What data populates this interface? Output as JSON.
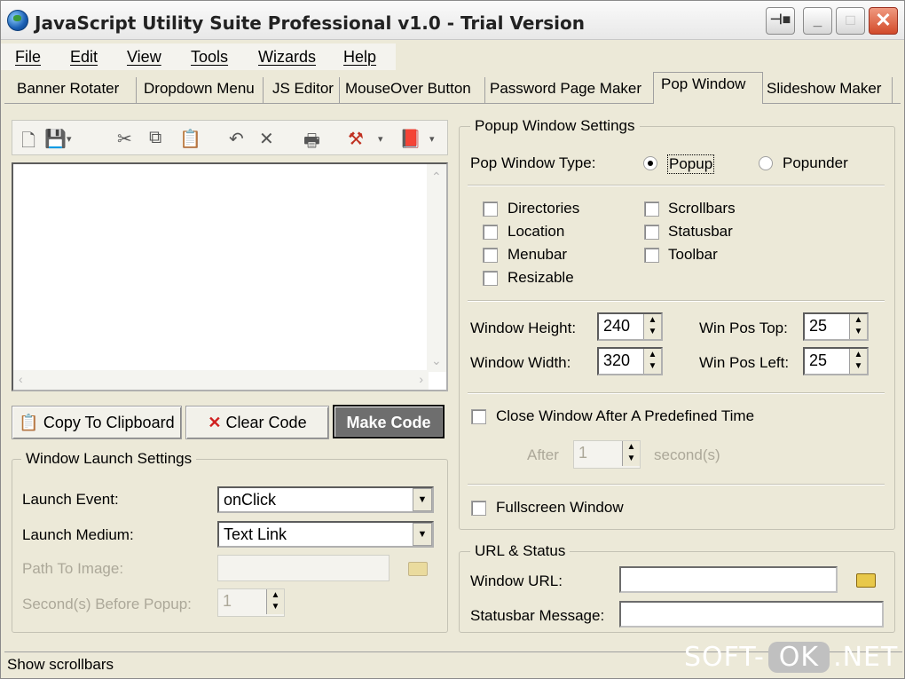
{
  "app": {
    "title": "JavaScript Utility Suite Professional v1.0 - Trial Version"
  },
  "menu": [
    "File",
    "Edit",
    "View",
    "Tools",
    "Wizards",
    "Help"
  ],
  "tabs": [
    "Banner Rotater",
    "Dropdown Menu",
    "JS Editor",
    "MouseOver Button",
    "Password Page Maker",
    "Pop Window",
    "Slideshow Maker"
  ],
  "active_tab": "Pop Window",
  "buttons": {
    "copy": "Copy To Clipboard",
    "clear": "Clear Code",
    "make": "Make Code"
  },
  "launch": {
    "title": "Window Launch Settings",
    "event_label": "Launch Event:",
    "event_value": "onClick",
    "medium_label": "Launch Medium:",
    "medium_value": "Text Link",
    "path_label": "Path To Image:",
    "seconds_label": "Second(s) Before Popup:",
    "seconds_value": "1"
  },
  "popup": {
    "title": "Popup Window Settings",
    "type_label": "Pop Window Type:",
    "type_popup": "Popup",
    "type_popunder": "Popunder",
    "selected_type": "Popup",
    "checkboxes_left": [
      "Directories",
      "Location",
      "Menubar",
      "Resizable"
    ],
    "checkboxes_right": [
      "Scrollbars",
      "Statusbar",
      "Toolbar"
    ],
    "height_label": "Window Height:",
    "height_value": "240",
    "width_label": "Window Width:",
    "width_value": "320",
    "postop_label": "Win Pos Top:",
    "postop_value": "25",
    "posleft_label": "Win Pos Left:",
    "posleft_value": "25",
    "close_label": "Close Window After A Predefined Time",
    "after_label": "After",
    "after_value": "1",
    "seconds_unit": "second(s)",
    "fullscreen_label": "Fullscreen Window"
  },
  "url": {
    "title": "URL & Status",
    "window_url_label": "Window URL:",
    "statusbar_label": "Statusbar Message:"
  },
  "statusbar": {
    "text": "Show scrollbars"
  },
  "watermark": {
    "left": "SOFT-",
    "mid": "OK",
    "right": ".NET"
  }
}
